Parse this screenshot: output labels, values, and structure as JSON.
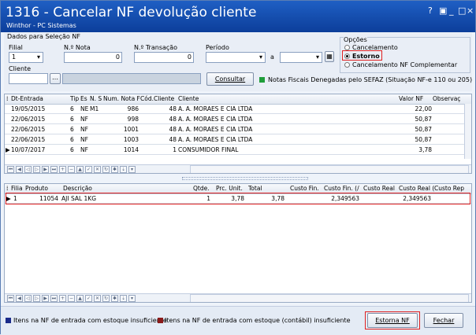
{
  "window": {
    "title": "1316 - Cancelar NF devolução cliente",
    "subtitle": "Winthor - PC Sistemas",
    "controls": [
      "?",
      "▣",
      "_",
      "□",
      "×"
    ]
  },
  "filters": {
    "group_title": "Dados para Seleção NF",
    "filial_label": "Filial",
    "filial_value": "1",
    "nnota_label": "N.º Nota",
    "nnota_value": "0",
    "ntransacao_label": "N.º Transação",
    "ntransacao_value": "0",
    "periodo_label": "Período",
    "periodo_sep": "a",
    "cliente_label": "Cliente",
    "consultar_label": "Consultar",
    "denegadas_label": "Notas Fiscais Denegadas pelo SEFAZ (Situação NF-e 110 ou 205)",
    "denegadas_color": "#1f9d3a"
  },
  "options": {
    "title": "Opções",
    "items": [
      {
        "label": "Cancelamento",
        "selected": false
      },
      {
        "label": "Estorno",
        "selected": true
      },
      {
        "label": "Cancelamento NF Complementar",
        "selected": false
      }
    ]
  },
  "grid1": {
    "headers": [
      "Dt-Entrada",
      "Tip",
      "Es",
      "N. S",
      "Num. Nota F",
      "Cód.Cliente",
      "Cliente",
      "Valor NF",
      "Observaç"
    ],
    "rows": [
      [
        "19/05/2015",
        "6",
        "NE",
        "M1",
        "986",
        "48",
        "A. A. MORAES E CIA LTDA",
        "22,00"
      ],
      [
        "22/06/2015",
        "6",
        "NF",
        "",
        "998",
        "48",
        "A. A. MORAES E CIA LTDA",
        "50,87"
      ],
      [
        "22/06/2015",
        "6",
        "NF",
        "",
        "1001",
        "48",
        "A. A. MORAES E CIA LTDA",
        "50,87"
      ],
      [
        "22/06/2015",
        "6",
        "NF",
        "",
        "1003",
        "48",
        "A. A. MORAES E CIA LTDA",
        "50,87"
      ],
      [
        "10/07/2017",
        "6",
        "NF",
        "",
        "1014",
        "1",
        "CONSUMIDOR FINAL",
        "3,78"
      ]
    ]
  },
  "grid2": {
    "headers": [
      "Filia",
      "Produto",
      "Descrição",
      "Qtde.",
      "Prc. Unit.",
      "Total",
      "Custo Fin.",
      "Custo Fin. (/",
      "Custo Real",
      "Custo Real (",
      "Custo Rep"
    ],
    "rows": [
      [
        "1",
        "11054",
        "AJI SAL 1KG",
        "1",
        "3,78",
        "3,78",
        "",
        "2,349563",
        "",
        "2,349563",
        ""
      ]
    ]
  },
  "footer": {
    "legend1": "Itens na NF de entrada com estoque insuficiente",
    "legend1_color": "#1a2a8a",
    "legend2": "Itens na NF de entrada com estoque (contábil) insuficiente",
    "legend2_color": "#8a1a1a",
    "estorna_label": "Estorna NF",
    "fechar_label": "Fechar"
  },
  "accent": {
    "title_bar": "#1554b8",
    "highlight_box": "#e02020"
  }
}
